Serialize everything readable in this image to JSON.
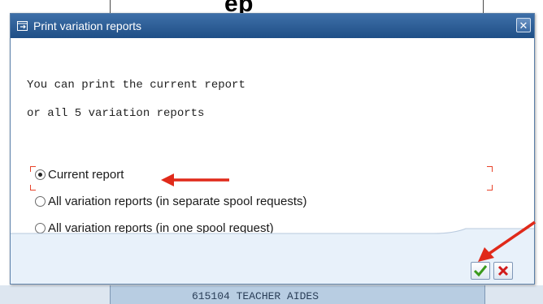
{
  "background": {
    "title_fragment": "ep",
    "bottom_text": "615104  TEACHER AIDES"
  },
  "dialog": {
    "title": "Print variation reports",
    "message_line1": "You can print the current report",
    "message_line2": "or all 5 variation reports",
    "options": [
      {
        "label": "Current report",
        "selected": true
      },
      {
        "label": "All variation reports (in separate spool requests)",
        "selected": false
      },
      {
        "label": "All variation reports (in one spool request)",
        "selected": false
      }
    ],
    "buttons": {
      "confirm_icon": "check-icon",
      "cancel_icon": "x-icon"
    }
  },
  "colors": {
    "titlebar": "#2a5c96",
    "annotation_arrow": "#e02a1a",
    "confirm_check": "#3a9a1c",
    "cancel_x": "#d11b1b"
  }
}
